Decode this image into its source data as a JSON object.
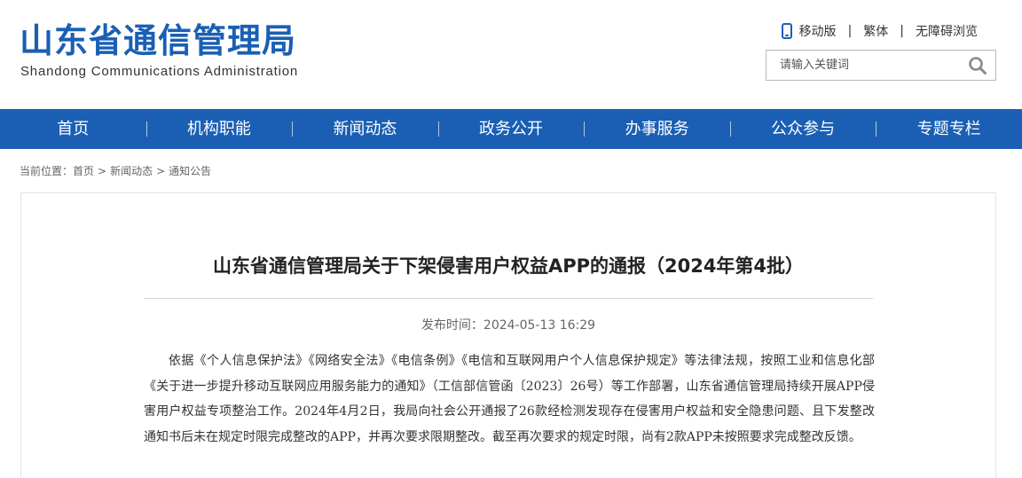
{
  "header": {
    "logo_cn": "山东省通信管理局",
    "logo_en": "Shandong Communications Administration",
    "top_links": {
      "mobile": "移动版",
      "traditional": "繁体",
      "accessible": "无障碍浏览"
    },
    "separator": "|",
    "search": {
      "placeholder": "请输入关键词"
    }
  },
  "nav": {
    "items": [
      {
        "label": "首页"
      },
      {
        "label": "机构职能"
      },
      {
        "label": "新闻动态"
      },
      {
        "label": "政务公开"
      },
      {
        "label": "办事服务"
      },
      {
        "label": "公众参与"
      },
      {
        "label": "专题专栏"
      }
    ]
  },
  "breadcrumb": {
    "prefix": "当前位置：",
    "items": [
      "首页",
      "新闻动态",
      "通知公告"
    ],
    "arrow": ">"
  },
  "article": {
    "title": "山东省通信管理局关于下架侵害用户权益APP的通报（2024年第4批）",
    "pubdate": "发布时间：2024-05-13 16:29",
    "body": "依据《个人信息保护法》《网络安全法》《电信条例》《电信和互联网用户个人信息保护规定》等法律法规，按照工业和信息化部《关于进一步提升移动互联网应用服务能力的通知》（工信部信管函〔2023〕26号）等工作部署，山东省通信管理局持续开展APP侵害用户权益专项整治工作。2024年4月2日，我局向社会公开通报了26款经检测发现存在侵害用户权益和安全隐患问题、且下发整改通知书后未在规定时限完成整改的APP，并再次要求限期整改。截至再次要求的规定时限，尚有2款APP未按照要求完成整改反馈。"
  },
  "colors": {
    "brand_blue": "#1a5fb4",
    "text": "#333333",
    "muted": "#666666"
  },
  "icons": {
    "mobile": "phone-icon",
    "search": "search-icon"
  }
}
